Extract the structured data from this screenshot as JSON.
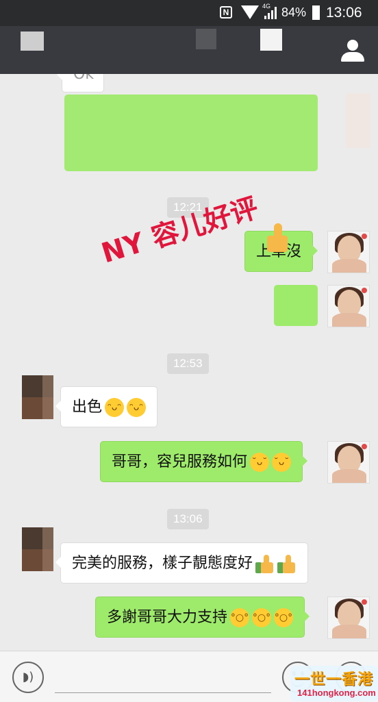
{
  "status_bar": {
    "nfc": "N",
    "network": "4G",
    "battery": "84%",
    "time": "13:06"
  },
  "chat": {
    "partial_top_text": "Ok",
    "timestamps": [
      "12:21",
      "12:53",
      "13:06"
    ],
    "messages": [
      {
        "from": "me",
        "text": "上車沒"
      },
      {
        "from": "friend",
        "text": "出色"
      },
      {
        "from": "me",
        "text": "哥哥，容兒服務如何"
      },
      {
        "from": "friend",
        "text": "完美的服務，樣子靚態度好"
      },
      {
        "from": "me",
        "text": "多謝哥哥大力支持"
      }
    ]
  },
  "watermark": {
    "text": "NY 容儿好评"
  },
  "logo": {
    "title": "一世一香港",
    "url": "141hongkong.com"
  },
  "colors": {
    "outgoing_bubble": "#9eea6a",
    "incoming_bubble": "#ffffff",
    "background": "#ebebeb",
    "titlebar": "#393a3f",
    "watermark": "#e0163c"
  },
  "icons": {
    "voice": "voice-icon",
    "emoji": "emoji-icon",
    "plus": "plus-icon",
    "profile": "profile-icon"
  }
}
